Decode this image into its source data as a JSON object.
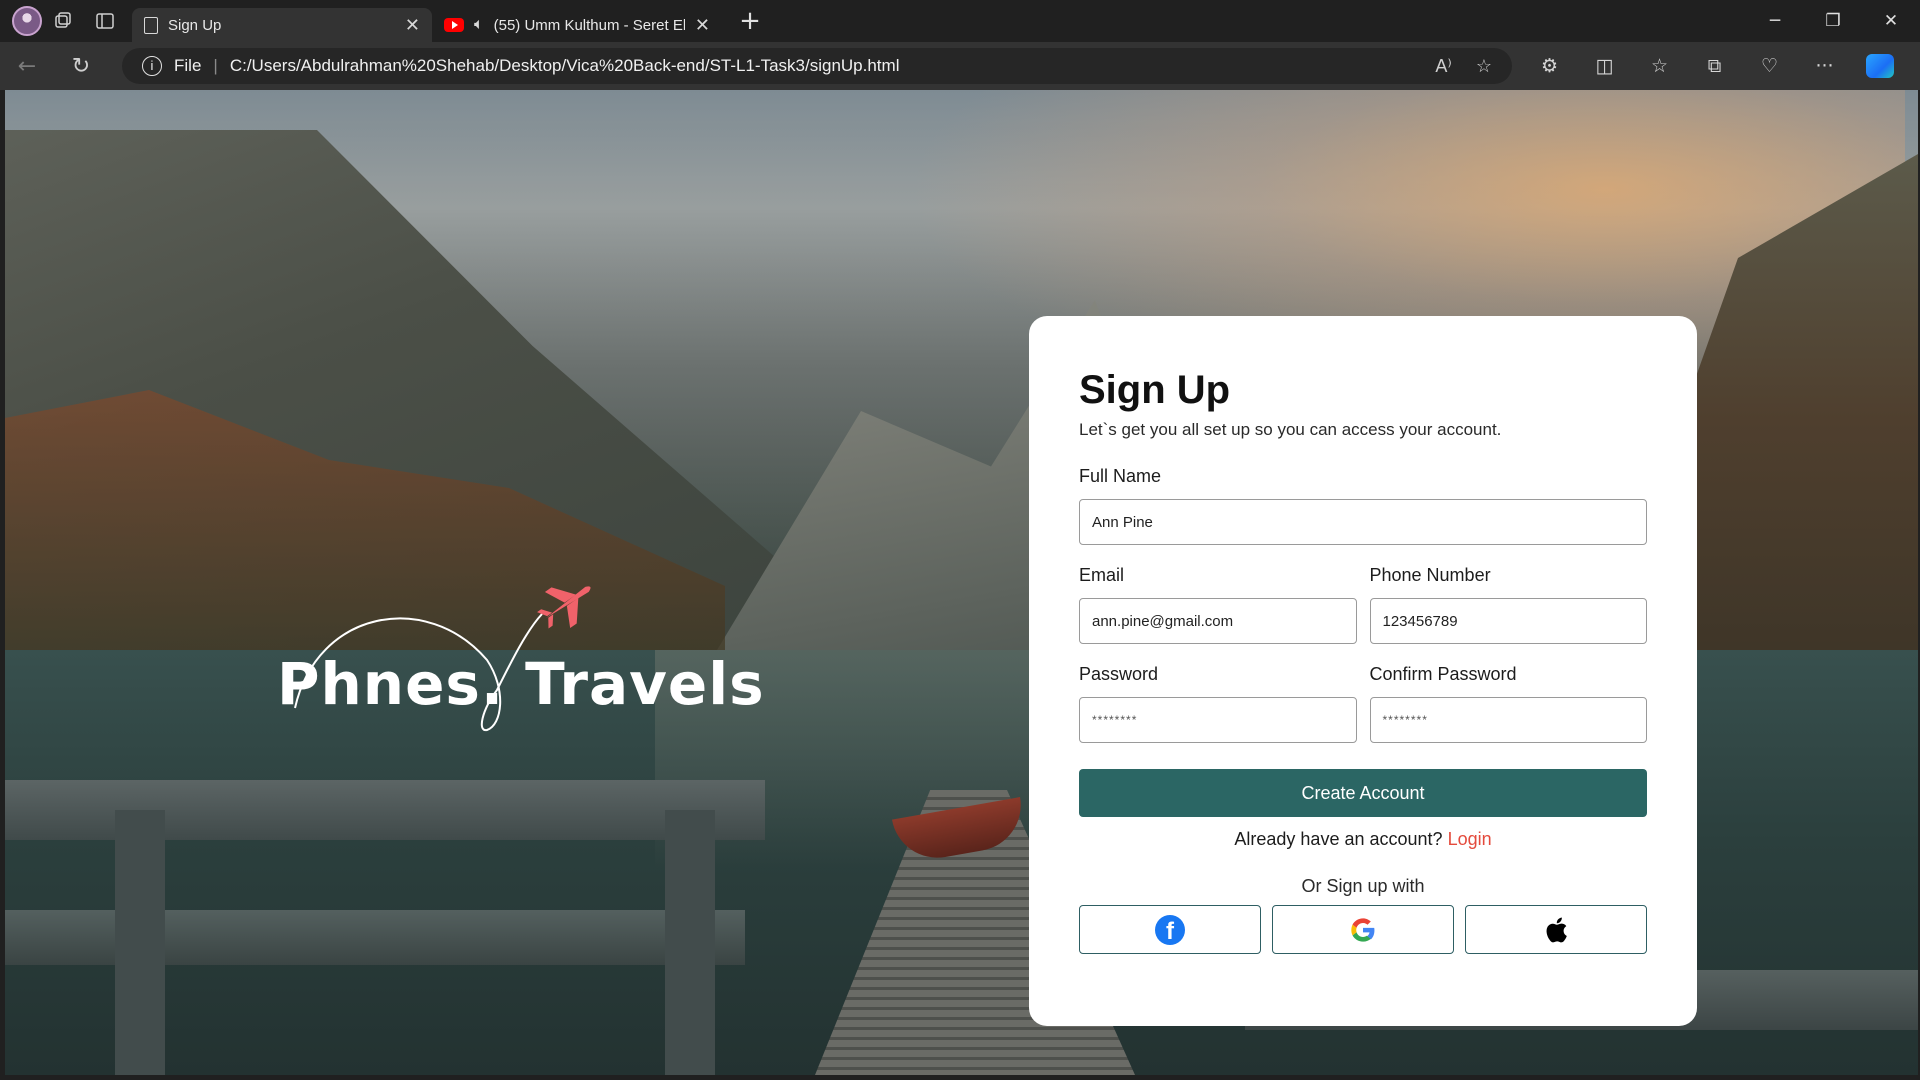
{
  "browser": {
    "tabs": [
      {
        "title": "Sign Up",
        "active": true
      },
      {
        "title": "(55) Umm Kulthum - Seret El",
        "active": false
      }
    ],
    "address": {
      "scheme_label": "File",
      "url": "C:/Users/Abdulrahman%20Shehab/Desktop/Vica%20Back-end/ST-L1-Task3/signUp.html"
    },
    "colors": {
      "tabbar": "#202020",
      "toolbar": "#333333"
    }
  },
  "logo": {
    "text": "Phnes. Travels",
    "plane_color": "#f0626a"
  },
  "form": {
    "title": "Sign Up",
    "subtitle": "Let`s get you all set up so you can access your account.",
    "full_name": {
      "label": "Full Name",
      "value": "Ann Pine"
    },
    "email": {
      "label": "Email",
      "value": "ann.pine@gmail.com"
    },
    "phone": {
      "label": "Phone Number",
      "value": "123456789"
    },
    "password": {
      "label": "Password",
      "value": "********"
    },
    "confirm_password": {
      "label": "Confirm Password",
      "value": "********"
    },
    "submit_label": "Create Account",
    "login_prompt": "Already have an account?",
    "login_link": "Login",
    "or_text": "Or Sign up with",
    "social_providers": [
      "facebook-icon",
      "google-icon",
      "apple-icon"
    ],
    "colors": {
      "primary": "#2b6664",
      "link": "#e44a3c",
      "social_border": "#2e5e63"
    }
  }
}
